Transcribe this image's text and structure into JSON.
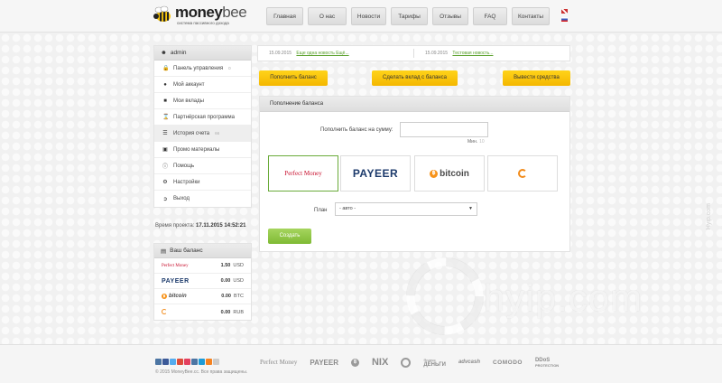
{
  "brand": {
    "name_part1": "money",
    "name_part2": "bee",
    "tagline": "система пассивного дохода",
    "accent_yellow": "#f6c40d",
    "accent_green": "#7fba34"
  },
  "nav": {
    "items": [
      "Главная",
      "О нас",
      "Новости",
      "Тарифы",
      "Отзывы",
      "FAQ",
      "Контакты"
    ],
    "languages": [
      "en",
      "ru"
    ]
  },
  "sidebar": {
    "user": "admin",
    "items": [
      {
        "label": "Панель управления",
        "badge": "0",
        "icon": "lock-icon"
      },
      {
        "label": "Мой аккаунт",
        "icon": "user-icon"
      },
      {
        "label": "Мои вклады",
        "icon": "box-icon"
      },
      {
        "label": "Партнёрская программа",
        "icon": "hourglass-icon"
      },
      {
        "label": "История счета",
        "badge": "66",
        "icon": "list-icon"
      },
      {
        "label": "Промо материалы",
        "icon": "monitor-icon"
      },
      {
        "label": "Помощь",
        "icon": "info-icon"
      },
      {
        "label": "Настройки",
        "icon": "gear-icon"
      },
      {
        "label": "Выход",
        "icon": "logout-icon"
      }
    ],
    "project_time_label": "Время проекта:",
    "project_time": "17.11.2015 14:52:21",
    "balance_title": "Ваш баланс",
    "balances": [
      {
        "system": "Perfect Money",
        "amount": "1.50",
        "currency": "USD"
      },
      {
        "system": "PAYEER",
        "amount": "0.00",
        "currency": "USD"
      },
      {
        "system": "bitcoin",
        "amount": "0.00",
        "currency": "BTC"
      },
      {
        "system": "AdvCash",
        "amount": "0.00",
        "currency": "RUB"
      }
    ]
  },
  "news": [
    {
      "date": "15.09.2015",
      "title": "Еще одна новость Ещё..."
    },
    {
      "date": "15.09.2015",
      "title": "Тестовая новость..."
    }
  ],
  "actions": {
    "deposit": "Пополнить баланс",
    "make_investment": "Сделать вклад с баланса",
    "withdraw": "Вывести средства"
  },
  "form": {
    "title": "Пополнение баланса",
    "amount_label": "Пополнить баланс на сумму:",
    "amount_value": "",
    "min_label": "Мин.",
    "min_value": "10",
    "payment_systems": [
      "Perfect Money",
      "PAYEER",
      "bitcoin",
      "AdvCash"
    ],
    "selected_payment": "Perfect Money",
    "plan_label": "План",
    "plan_value": "- авто -",
    "submit": "Создать"
  },
  "watermark": {
    "text": "hyip.com",
    "side_text": "Hyip.com"
  },
  "footer": {
    "copyright": "© 2015 MoneyBee.cc. Все права защищены.",
    "social_colors": [
      "#4c75a3",
      "#3b5998",
      "#55acee",
      "#dd4b39",
      "#e4405f",
      "#4c75a3",
      "#1d9bd7",
      "#f58220",
      "#cccccc"
    ],
    "partners": [
      "Perfect Money",
      "PAYEER",
      "bitcoin",
      "NIX MONEY",
      "QIWI",
      "Яндекс Деньги",
      "advcash",
      "COMODO",
      "DDoS PROTECTION"
    ],
    "yd_line1": "Яндекс",
    "yd_line2": "ДЕНЬГИ",
    "ddos_line1": "DDoS",
    "ddos_line2": "PROTECTION"
  }
}
